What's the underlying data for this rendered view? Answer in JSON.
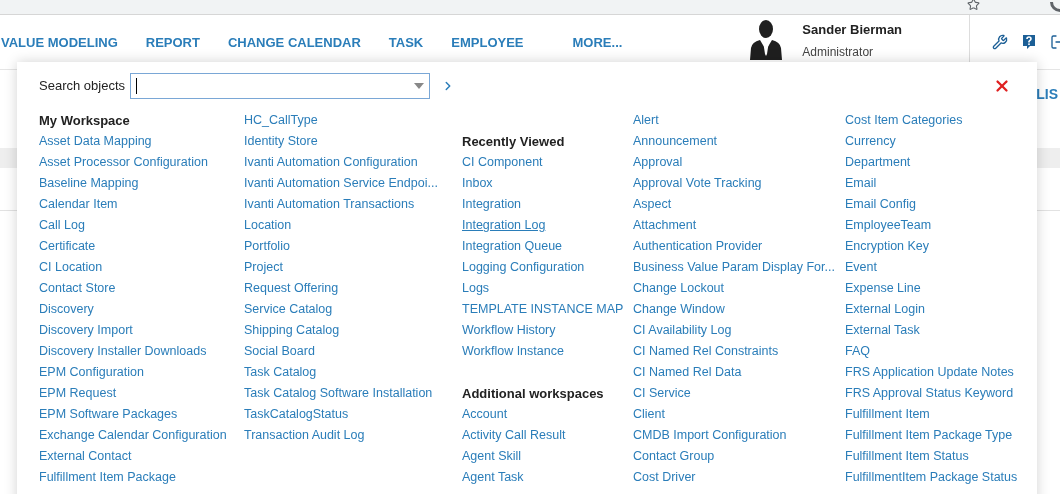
{
  "nav": {
    "items": [
      {
        "label": "VALUE MODELING"
      },
      {
        "label": "REPORT"
      },
      {
        "label": "CHANGE CALENDAR"
      },
      {
        "label": "TASK"
      },
      {
        "label": "EMPLOYEE"
      },
      {
        "label": "MORE..."
      }
    ],
    "user": {
      "name": "Sander Bierman",
      "role": "Administrator"
    }
  },
  "background": {
    "side_label": "LIS"
  },
  "panel": {
    "search": {
      "label": "Search objects"
    },
    "columns": [
      {
        "groups": [
          {
            "heading": "My Workspace",
            "items": [
              {
                "label": "Asset Data Mapping",
                "hovered": false
              },
              {
                "label": "Asset Processor Configuration",
                "hovered": false
              },
              {
                "label": "Baseline Mapping",
                "hovered": false
              },
              {
                "label": "Calendar Item",
                "hovered": false
              },
              {
                "label": "Call Log",
                "hovered": false
              },
              {
                "label": "Certificate",
                "hovered": false
              },
              {
                "label": "CI Location",
                "hovered": false
              },
              {
                "label": "Contact Store",
                "hovered": false
              },
              {
                "label": "Discovery",
                "hovered": false
              },
              {
                "label": "Discovery Import",
                "hovered": false
              },
              {
                "label": "Discovery Installer Downloads",
                "hovered": false
              },
              {
                "label": "EPM Configuration",
                "hovered": false
              },
              {
                "label": "EPM Request",
                "hovered": false
              },
              {
                "label": "EPM Software Packages",
                "hovered": false
              },
              {
                "label": "Exchange Calendar Configuration",
                "hovered": false
              },
              {
                "label": "External Contact",
                "hovered": false
              },
              {
                "label": "Fulfillment Item Package",
                "hovered": false
              }
            ]
          }
        ]
      },
      {
        "groups": [
          {
            "items": [
              {
                "label": "HC_CallType",
                "hovered": false
              },
              {
                "label": "Identity Store",
                "hovered": false
              },
              {
                "label": "Ivanti Automation Configuration",
                "hovered": false
              },
              {
                "label": "Ivanti Automation Service Endpoi...",
                "hovered": false
              },
              {
                "label": "Ivanti Automation Transactions",
                "hovered": false
              },
              {
                "label": "Location",
                "hovered": false
              },
              {
                "label": "Portfolio",
                "hovered": false
              },
              {
                "label": "Project",
                "hovered": false
              },
              {
                "label": "Request Offering",
                "hovered": false
              },
              {
                "label": "Service Catalog",
                "hovered": false
              },
              {
                "label": "Shipping Catalog",
                "hovered": false
              },
              {
                "label": "Social Board",
                "hovered": false
              },
              {
                "label": "Task Catalog",
                "hovered": false
              },
              {
                "label": "Task Catalog Software Installation",
                "hovered": false
              },
              {
                "label": "TaskCatalogStatus",
                "hovered": false
              },
              {
                "label": "Transaction Audit Log",
                "hovered": false
              }
            ]
          }
        ]
      },
      {
        "groups": [
          {
            "heading": "Recently Viewed",
            "items": [
              {
                "label": "CI Component",
                "hovered": false
              },
              {
                "label": "Inbox",
                "hovered": false
              },
              {
                "label": "Integration",
                "hovered": false
              },
              {
                "label": "Integration Log",
                "hovered": true
              },
              {
                "label": "Integration Queue",
                "hovered": false
              },
              {
                "label": "Logging Configuration",
                "hovered": false
              },
              {
                "label": "Logs",
                "hovered": false
              },
              {
                "label": "TEMPLATE INSTANCE MAP",
                "hovered": false
              },
              {
                "label": "Workflow History",
                "hovered": false
              },
              {
                "label": "Workflow Instance",
                "hovered": false
              }
            ]
          },
          {
            "heading": "Additional workspaces",
            "items": [
              {
                "label": "Account",
                "hovered": false
              },
              {
                "label": "Activity Call Result",
                "hovered": false
              },
              {
                "label": "Agent Skill",
                "hovered": false
              },
              {
                "label": "Agent Task",
                "hovered": false
              }
            ]
          }
        ]
      },
      {
        "groups": [
          {
            "items": [
              {
                "label": "Alert",
                "hovered": false
              },
              {
                "label": "Announcement",
                "hovered": false
              },
              {
                "label": "Approval",
                "hovered": false
              },
              {
                "label": "Approval Vote Tracking",
                "hovered": false
              },
              {
                "label": "Aspect",
                "hovered": false
              },
              {
                "label": "Attachment",
                "hovered": false
              },
              {
                "label": "Authentication Provider",
                "hovered": false
              },
              {
                "label": "Business Value Param Display For...",
                "hovered": false
              },
              {
                "label": "Change Lockout",
                "hovered": false
              },
              {
                "label": "Change Window",
                "hovered": false
              },
              {
                "label": "CI Availability Log",
                "hovered": false
              },
              {
                "label": "CI Named Rel Constraints",
                "hovered": false
              },
              {
                "label": "CI Named Rel Data",
                "hovered": false
              },
              {
                "label": "CI Service",
                "hovered": false
              },
              {
                "label": "Client",
                "hovered": false
              },
              {
                "label": "CMDB Import Configuration",
                "hovered": false
              },
              {
                "label": "Contact Group",
                "hovered": false
              },
              {
                "label": "Cost Driver",
                "hovered": false
              }
            ]
          }
        ]
      },
      {
        "groups": [
          {
            "items": [
              {
                "label": "Cost Item Categories",
                "hovered": false
              },
              {
                "label": "Currency",
                "hovered": false
              },
              {
                "label": "Department",
                "hovered": false
              },
              {
                "label": "Email",
                "hovered": false
              },
              {
                "label": "Email Config",
                "hovered": false
              },
              {
                "label": "EmployeeTeam",
                "hovered": false
              },
              {
                "label": "Encryption Key",
                "hovered": false
              },
              {
                "label": "Event",
                "hovered": false
              },
              {
                "label": "Expense Line",
                "hovered": false
              },
              {
                "label": "External Login",
                "hovered": false
              },
              {
                "label": "External Task",
                "hovered": false
              },
              {
                "label": "FAQ",
                "hovered": false
              },
              {
                "label": "FRS Application Update Notes",
                "hovered": false
              },
              {
                "label": "FRS Approval Status Keyword",
                "hovered": false
              },
              {
                "label": "Fulfillment Item",
                "hovered": false
              },
              {
                "label": "Fulfillment Item Package Type",
                "hovered": false
              },
              {
                "label": "Fulfillment Item Status",
                "hovered": false
              },
              {
                "label": "FulfillmentItem Package Status",
                "hovered": false
              }
            ]
          }
        ]
      }
    ]
  }
}
